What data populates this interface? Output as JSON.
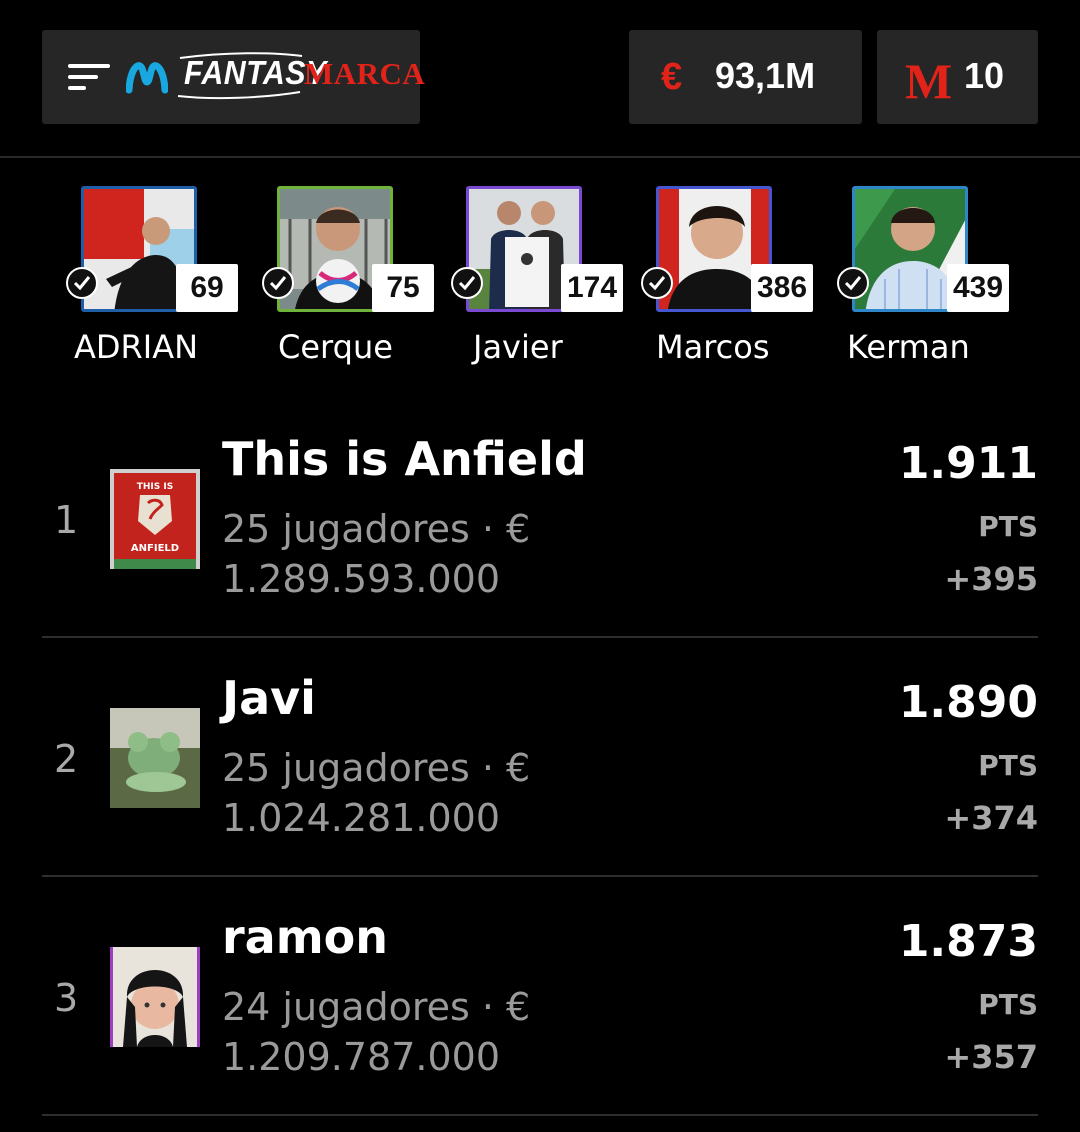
{
  "header": {
    "brand_fantasy": "FANTASY",
    "brand_marca": "MARCA",
    "budget_icon": "euro-icon",
    "budget": "93,1M",
    "marca_icon": "marca-m-icon",
    "marca_points": "10"
  },
  "followed_users": [
    {
      "name": "ADRIAN",
      "score": "69",
      "verified": true
    },
    {
      "name": "Cerque",
      "score": "75",
      "verified": true
    },
    {
      "name": "Javier",
      "score": "174",
      "verified": true
    },
    {
      "name": "Marcos",
      "score": "386",
      "verified": true
    },
    {
      "name": "Kerman",
      "score": "439",
      "verified": true
    }
  ],
  "ranking": [
    {
      "position": "1",
      "team": "This is Anfield",
      "players": "25 jugadores · €",
      "value": "1.289.593.000",
      "points": "1.911",
      "pts_label": "PTS",
      "delta": "+395"
    },
    {
      "position": "2",
      "team": "Javi",
      "players": "25 jugadores · €",
      "value": "1.024.281.000",
      "points": "1.890",
      "pts_label": "PTS",
      "delta": "+374"
    },
    {
      "position": "3",
      "team": "ramon",
      "players": "24 jugadores · €",
      "value": "1.209.787.000",
      "points": "1.873",
      "pts_label": "PTS",
      "delta": "+357"
    }
  ],
  "colors": {
    "background": "#000000",
    "card": "#262626",
    "accent_red": "#e2231a",
    "muted": "#a9a9a9"
  }
}
